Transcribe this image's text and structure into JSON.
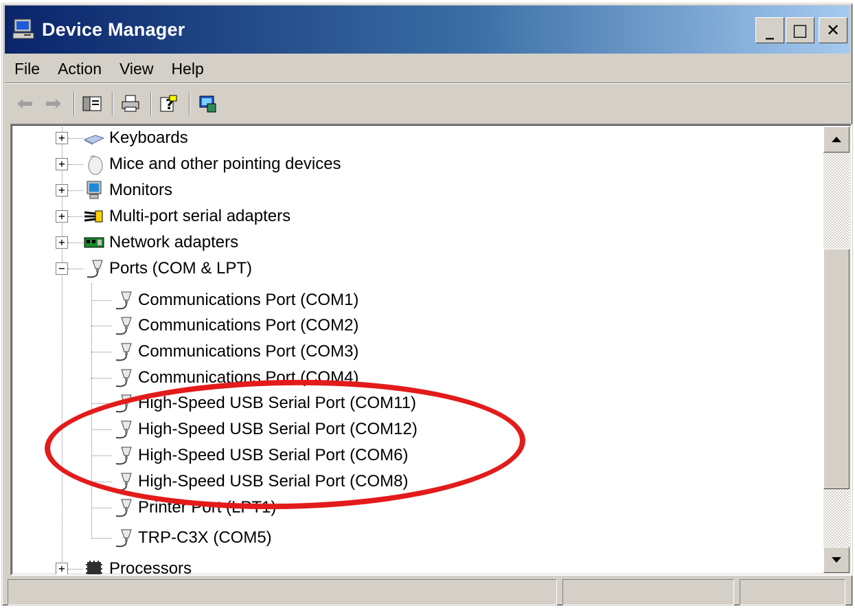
{
  "window": {
    "title": "Device Manager",
    "icon": "computer-icon",
    "minimize_label": "_",
    "maximize_label": "□",
    "close_label": "✕"
  },
  "menu": {
    "items": [
      "File",
      "Action",
      "View",
      "Help"
    ]
  },
  "toolbar": {
    "buttons": [
      "back-arrow-icon",
      "forward-arrow-icon",
      "console-tree-icon",
      "print-icon",
      "help-icon",
      "properties-icon"
    ]
  },
  "tree": {
    "nodes": [
      {
        "label": "Keyboards",
        "icon": "keyboard-icon",
        "expanded": false
      },
      {
        "label": "Mice and other pointing devices",
        "icon": "mouse-icon",
        "expanded": false
      },
      {
        "label": "Monitors",
        "icon": "monitor-icon",
        "expanded": false
      },
      {
        "label": "Multi-port serial adapters",
        "icon": "multiport-adapter-icon",
        "expanded": false
      },
      {
        "label": "Network adapters",
        "icon": "network-adapter-icon",
        "expanded": false
      },
      {
        "label": "Ports (COM & LPT)",
        "icon": "port-icon",
        "expanded": true
      },
      {
        "label": "Communications Port (COM1)",
        "icon": "port-icon",
        "child": true
      },
      {
        "label": "Communications Port (COM2)",
        "icon": "port-icon",
        "child": true
      },
      {
        "label": "Communications Port (COM3)",
        "icon": "port-icon",
        "child": true
      },
      {
        "label": "Communications Port (COM4)",
        "icon": "port-icon",
        "child": true
      },
      {
        "label": "High-Speed USB Serial Port (COM11)",
        "icon": "port-icon",
        "child": true
      },
      {
        "label": "High-Speed USB Serial Port (COM12)",
        "icon": "port-icon",
        "child": true
      },
      {
        "label": "High-Speed USB Serial Port (COM6)",
        "icon": "port-icon",
        "child": true
      },
      {
        "label": "High-Speed USB Serial Port (COM8)",
        "icon": "port-icon",
        "child": true
      },
      {
        "label": "Printer Port (LPT1)",
        "icon": "port-icon",
        "child": true
      },
      {
        "label": "TRP-C3X (COM5)",
        "icon": "port-icon",
        "child": true
      },
      {
        "label": "Processors",
        "icon": "processor-icon",
        "expanded": false
      }
    ]
  },
  "colors": {
    "titlebar_start": "#0a246a",
    "titlebar_end": "#a6caf0",
    "highlight": "#e31b1b",
    "chrome": "#d4d0c8"
  }
}
